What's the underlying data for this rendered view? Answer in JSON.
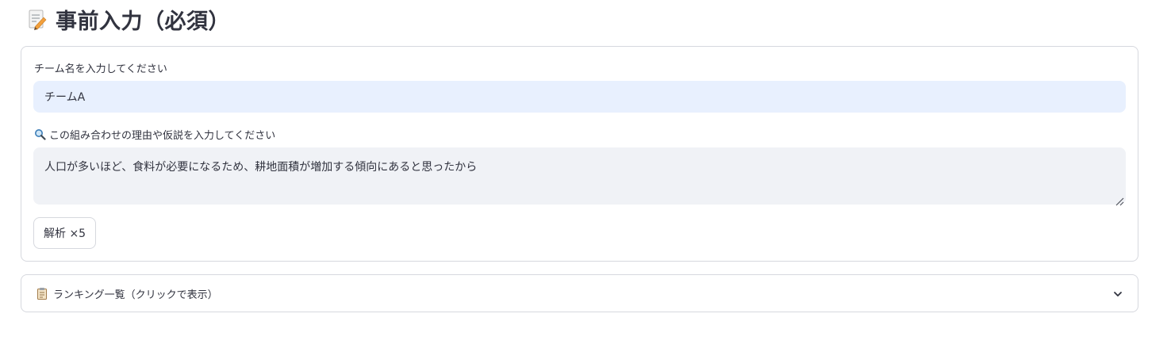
{
  "page": {
    "title": "事前入力（必須）",
    "title_icon": "memo-icon"
  },
  "form": {
    "team_label": "チーム名を入力してください",
    "team_value": "チームA",
    "reason_label": "この組み合わせの理由や仮説を入力してください",
    "reason_icon": "magnifying-glass-icon",
    "reason_value": "人口が多いほど、食料が必要になるため、耕地面積が増加する傾向にあると思ったから",
    "analyze_button_label": "解析 ×5"
  },
  "expander": {
    "label": "ランキング一覧（クリックで表示）",
    "icon": "clipboard-icon",
    "toggle_icon": "chevron-down-icon"
  },
  "colors": {
    "text": "#31333f",
    "input_bg": "#e8f0fe",
    "textarea_bg": "#f0f2f6",
    "border": "#d6d8de"
  }
}
